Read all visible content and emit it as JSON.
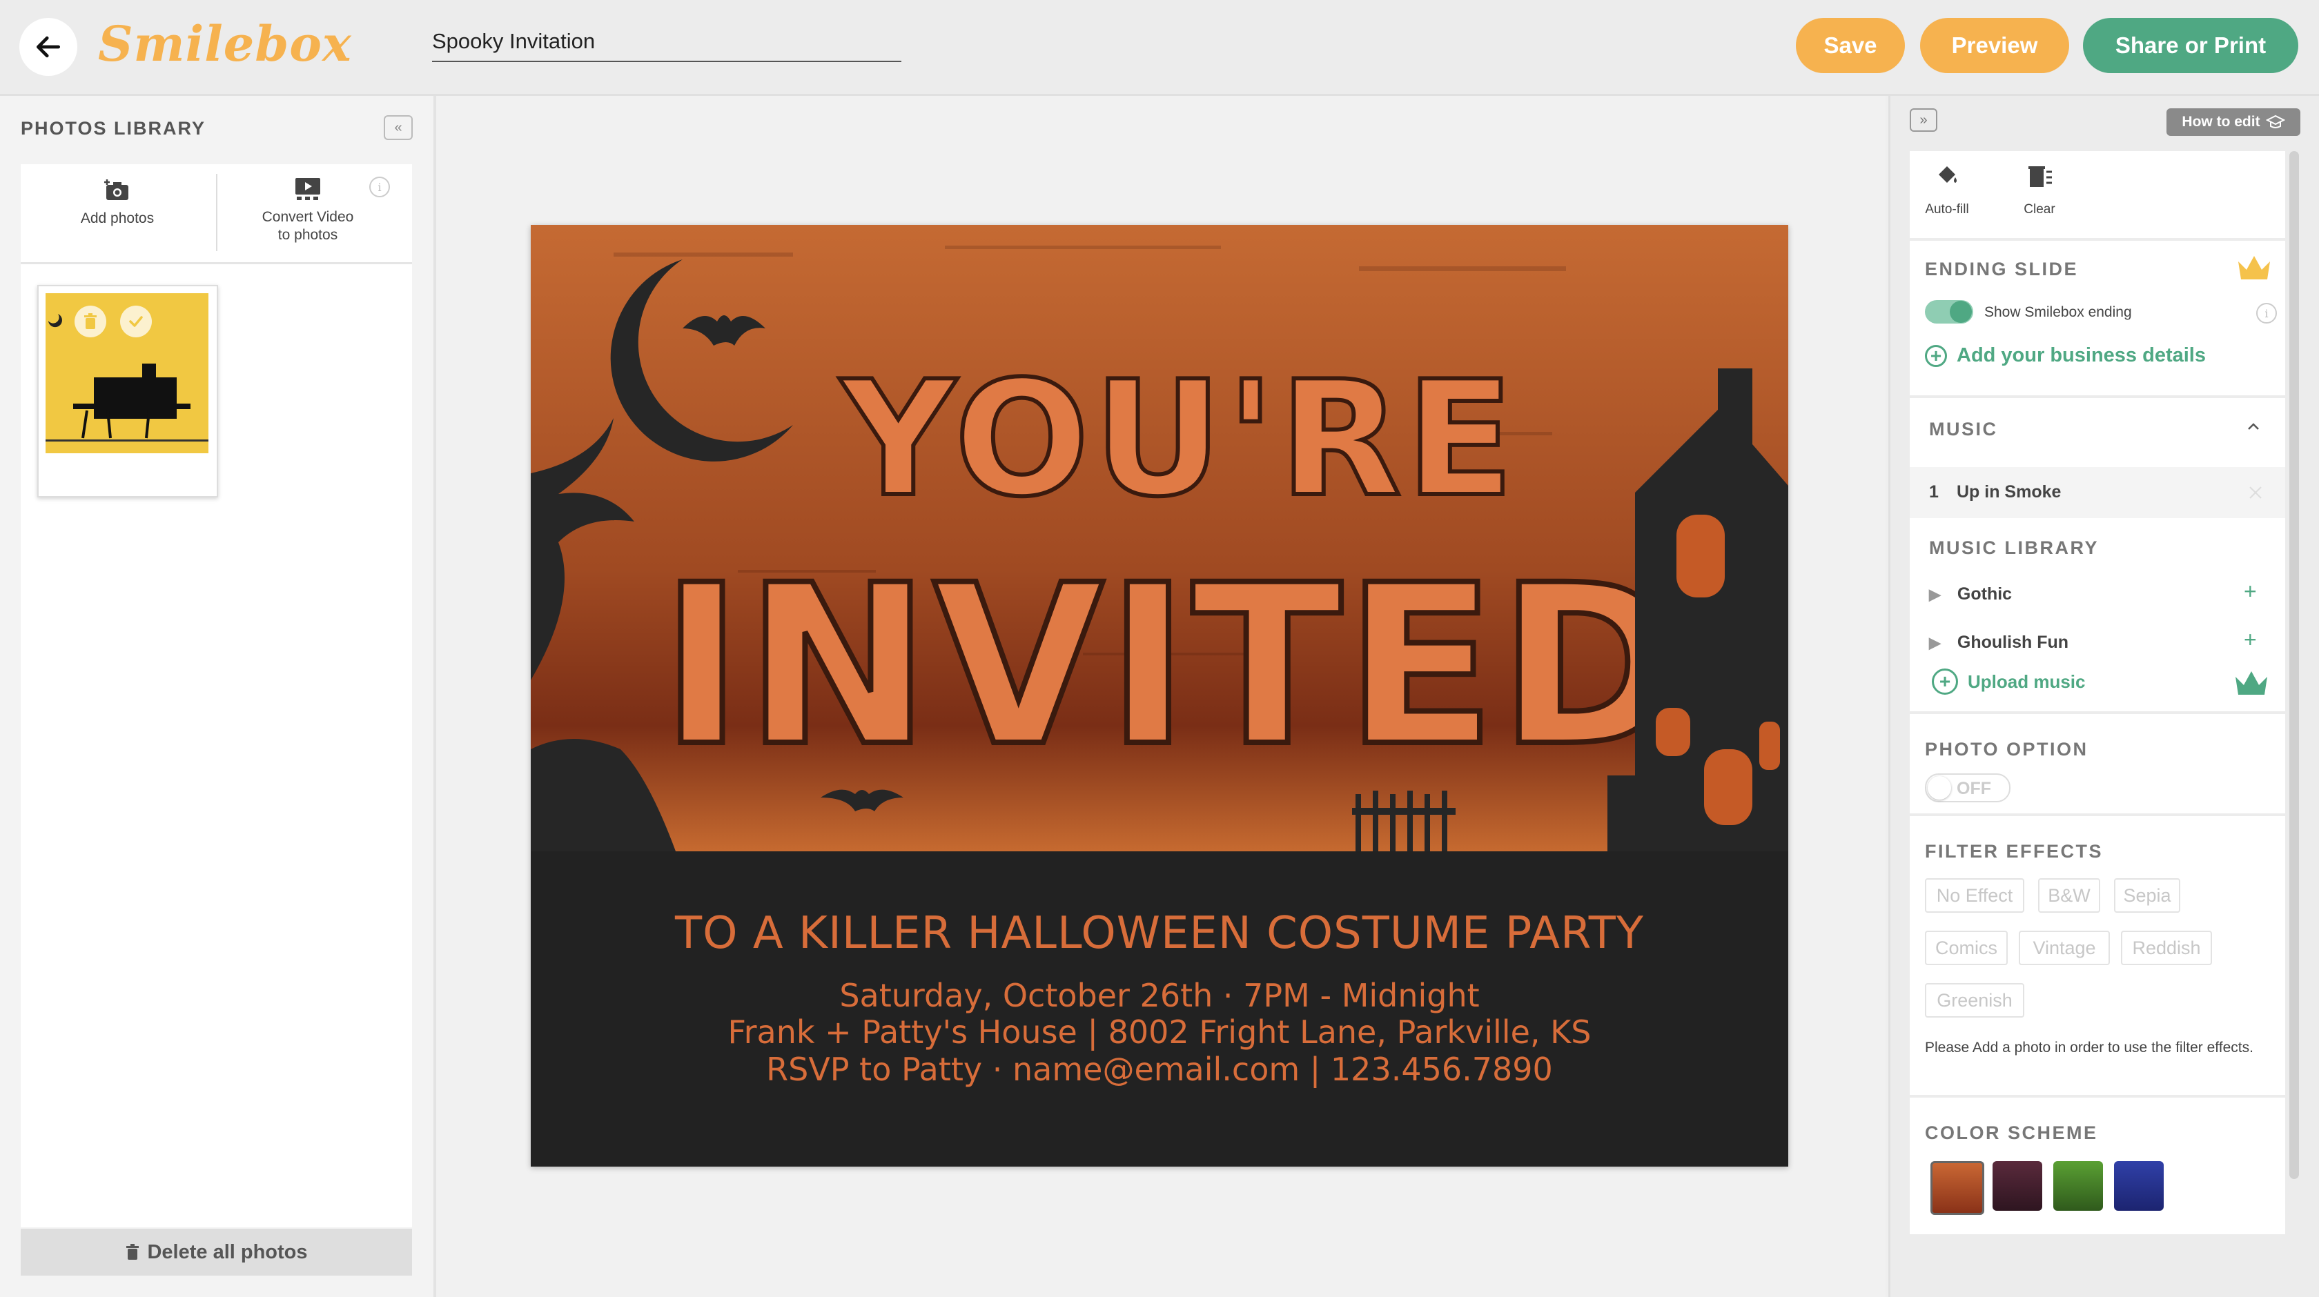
{
  "header": {
    "logo": "Smilebox",
    "project_title": "Spooky Invitation",
    "save_label": "Save",
    "preview_label": "Preview",
    "share_label": "Share or Print"
  },
  "left_panel": {
    "title": "PHOTOS LIBRARY",
    "add_photos": "Add photos",
    "convert_video_line1": "Convert Video",
    "convert_video_line2": "to photos",
    "delete_all": "Delete all photos"
  },
  "card": {
    "headline_line1": "YOU'RE",
    "headline_line2": "INVITED",
    "subtitle": "TO A KILLER HALLOWEEN COSTUME PARTY",
    "line1": "Saturday, October 26th · 7PM - Midnight",
    "line2": "Frank + Patty's House | 8002 Fright Lane, Parkville, KS",
    "line3": "RSVP to Patty · name@email.com | 123.456.7890"
  },
  "right_panel": {
    "how_to_edit": "How to edit",
    "tools": {
      "autofill": "Auto-fill",
      "clear": "Clear"
    },
    "ending_slide": {
      "title": "ENDING SLIDE",
      "toggle_label": "Show Smilebox ending",
      "toggle_on": true,
      "business_link": "Add your business details"
    },
    "music": {
      "title": "MUSIC",
      "track_number": "1",
      "track_name": "Up in Smoke",
      "library_title": "MUSIC LIBRARY",
      "library": [
        "Gothic",
        "Ghoulish Fun"
      ],
      "upload": "Upload music"
    },
    "photo_option": {
      "title": "PHOTO OPTION",
      "toggle_text": "OFF",
      "toggle_on": false
    },
    "filter_effects": {
      "title": "FILTER EFFECTS",
      "chips": [
        "No Effect",
        "B&W",
        "Sepia",
        "Comics",
        "Vintage",
        "Reddish",
        "Greenish"
      ],
      "note": "Please Add a photo in order to use the filter effects."
    },
    "color_scheme": {
      "title": "COLOR SCHEME",
      "swatches": [
        "#b4522a",
        "#4a2233",
        "#3f7a26",
        "#24308a"
      ]
    }
  },
  "colors": {
    "accent_orange": "#f6b24f",
    "accent_green": "#4fa883",
    "card_text": "#d86d3a",
    "premium_gold": "#f5c24b"
  }
}
